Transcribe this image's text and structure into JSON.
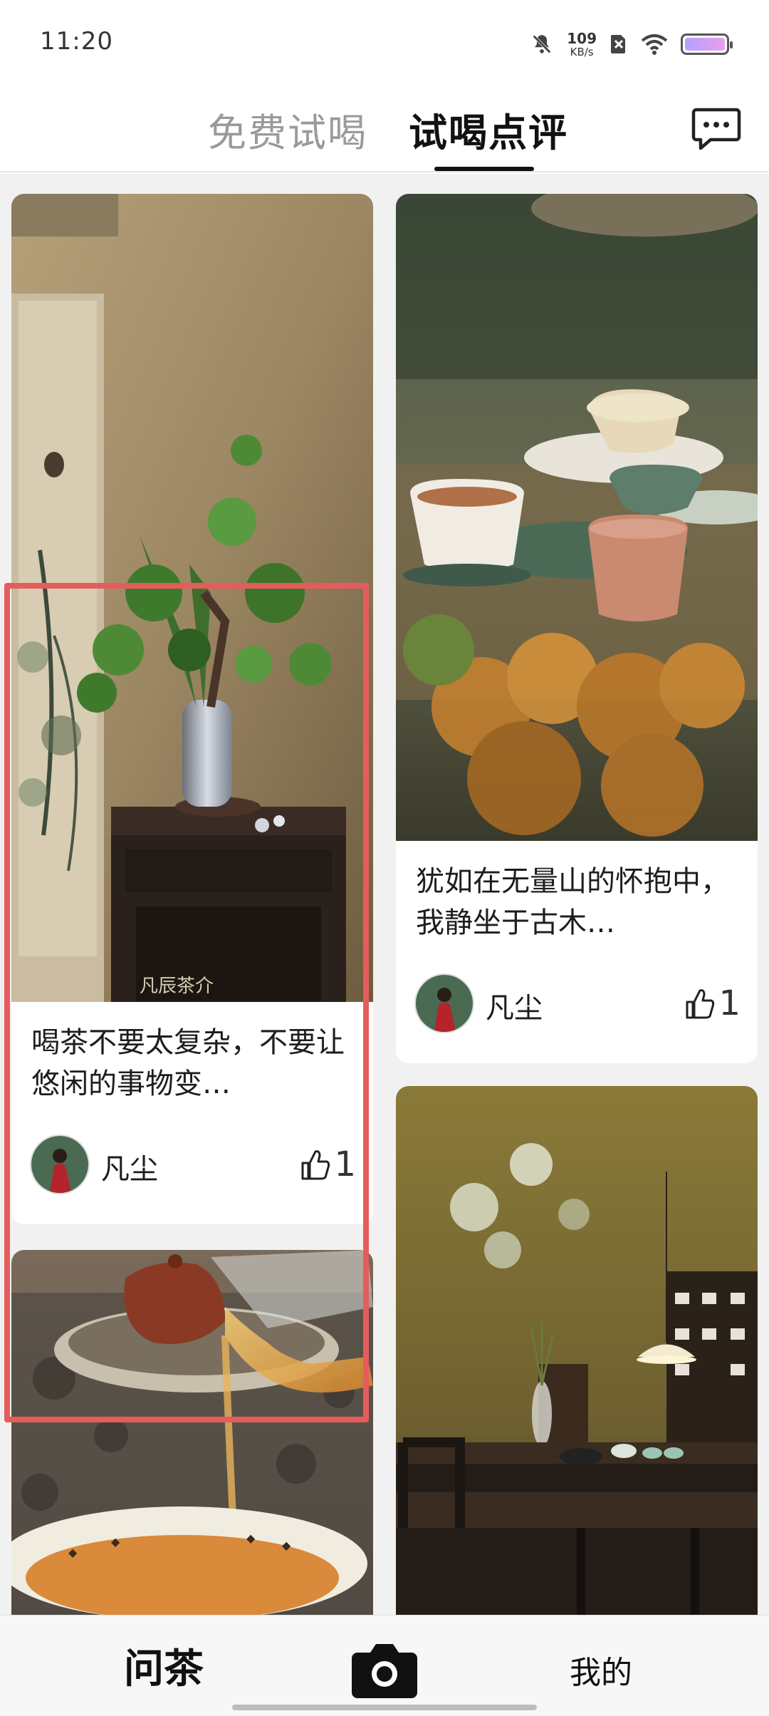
{
  "status": {
    "time": "11:20",
    "speed_value": "109",
    "speed_unit": "KB/s"
  },
  "header": {
    "tabs": [
      {
        "label": "免费试喝",
        "active": false
      },
      {
        "label": "试喝点评",
        "active": true
      }
    ],
    "message_icon": "chat-bubble-icon"
  },
  "feed": {
    "cards": [
      {
        "title": "喝茶不要太复杂，不要让悠闲的事物变…",
        "author": "凡尘",
        "likes": "1",
        "watermark": "凡辰茶介",
        "image": "tea-plant-still-life"
      },
      {
        "title": "犹如在无量山的怀抱中，我静坐于古木…",
        "author": "凡尘",
        "likes": "1",
        "image": "tea-cups-table"
      },
      {
        "title": "",
        "author": "",
        "likes": "",
        "image": "tea-pouring"
      },
      {
        "title": "",
        "author": "",
        "likes": "",
        "image": "tea-room-interior"
      }
    ]
  },
  "bottom_nav": {
    "left_label": "问茶",
    "center_icon": "camera-icon",
    "right_label": "我的"
  },
  "colors": {
    "highlight": "#e65c5c",
    "active_tab": "#111111",
    "inactive_tab": "#9a9a9a"
  }
}
